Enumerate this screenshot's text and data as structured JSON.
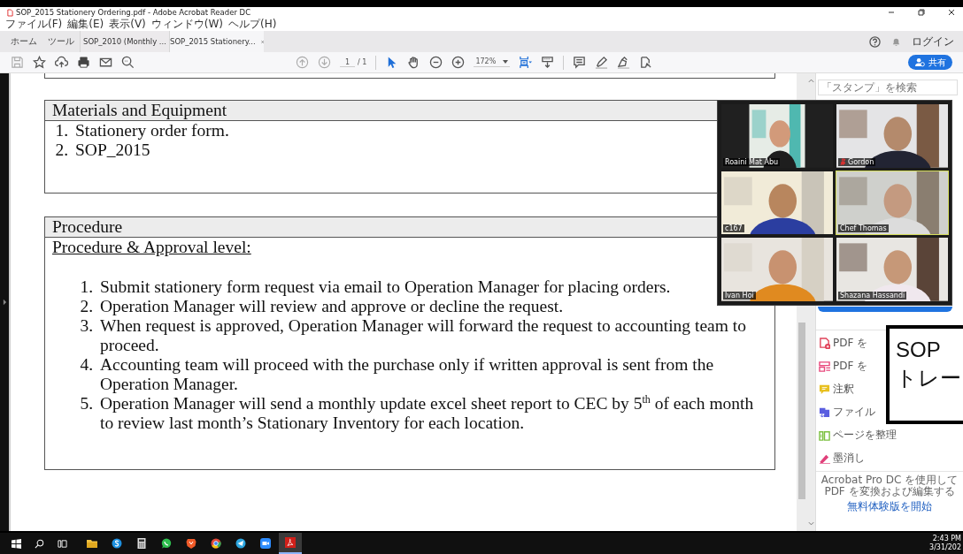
{
  "window": {
    "title": "SOP_2015 Stationery Ordering.pdf - Adobe Acrobat Reader DC"
  },
  "menu": [
    "ファイル(F)",
    "編集(E)",
    "表示(V)",
    "ウィンドウ(W)",
    "ヘルプ(H)"
  ],
  "tabs": [
    {
      "label": "ホーム",
      "kind": "home",
      "selected": false
    },
    {
      "label": "ツール",
      "kind": "home",
      "selected": false
    },
    {
      "label": "SOP_2010 (Monthly ...",
      "kind": "doc",
      "selected": false
    },
    {
      "label": "SOP_2015 Stationery...",
      "kind": "doc",
      "selected": true
    }
  ],
  "header_right": {
    "login": "ログイン"
  },
  "toolbar": {
    "page_current": "1",
    "page_total": "/ 1",
    "zoom": "172%",
    "share": "共有"
  },
  "document": {
    "sections": [
      {
        "heading": "Materials and Equipment",
        "items": [
          {
            "number": "1.",
            "text": "Stationery order form."
          },
          {
            "number": "2.",
            "text": "SOP_2015"
          }
        ]
      },
      {
        "heading": "Procedure",
        "subheading": "Procedure & Approval level:",
        "items": [
          {
            "number": "1.",
            "text": "Submit stationery form request via email to Operation Manager for placing orders."
          },
          {
            "number": "2.",
            "text": "Operation Manager will review and approve or decline the request."
          },
          {
            "number": "3.",
            "text": "When request is approved, Operation Manager will forward the request to accounting team to proceed."
          },
          {
            "number": "4.",
            "text": "Accounting team will proceed with the purchase only if written approval is sent from the Operation Manager."
          },
          {
            "number": "5.",
            "text": "Operation Manager will send a monthly update excel sheet report to CEC by 5$^{th}$ of each month to review last month’s Stationary Inventory for each location."
          }
        ]
      }
    ]
  },
  "right_pane": {
    "search_placeholder": "「スタンプ」を検索",
    "tools": [
      {
        "label": "PDF を",
        "color": "#e0435a"
      },
      {
        "label": "PDF を",
        "color": "#e8487c"
      },
      {
        "label": "注釈",
        "color": "#e8c020"
      },
      {
        "label": "ファイル",
        "color": "#5a5ee0"
      },
      {
        "label": "ページを整理",
        "color": "#7cc040"
      },
      {
        "label": "墨消し",
        "color": "#e0407a"
      }
    ],
    "promo": "Acrobat Pro DC を使用して PDF を変換および編集する",
    "promo_link": "無料体験版を開始"
  },
  "video_call": {
    "participants": [
      {
        "name": "Roaini Mat Abu",
        "muted": false,
        "active": false
      },
      {
        "name": "Gordon",
        "muted": true,
        "active": false
      },
      {
        "name": "c167",
        "muted": false,
        "active": false
      },
      {
        "name": "Chef Thomas",
        "muted": false,
        "active": true
      },
      {
        "name": "Ivan Hoi",
        "muted": false,
        "active": false
      },
      {
        "name": "Shazana Hassandi",
        "muted": false,
        "active": false
      }
    ]
  },
  "caption": {
    "lines": [
      "SOP",
      "トレー"
    ]
  },
  "taskbar": {
    "apps": [
      {
        "kind": "folder",
        "active": false
      },
      {
        "kind": "blue",
        "active": false
      },
      {
        "kind": "calculator",
        "active": false
      },
      {
        "kind": "green",
        "active": false
      },
      {
        "kind": "shield",
        "active": false
      },
      {
        "kind": "browser",
        "active": false
      },
      {
        "kind": "telegram",
        "active": false
      },
      {
        "kind": "video",
        "active": false
      },
      {
        "kind": "acrobat",
        "active": true
      }
    ],
    "time": "2:43 PM",
    "date": "3/31/202"
  }
}
